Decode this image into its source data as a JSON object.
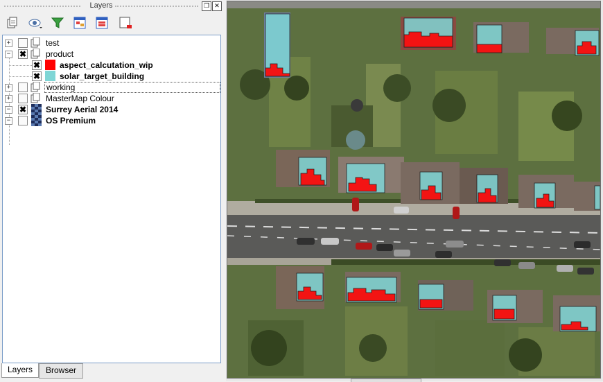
{
  "panel": {
    "title": "Layers",
    "float_glyph": "❐",
    "close_glyph": "✕"
  },
  "toolbar": {
    "buttons": [
      {
        "name": "add-group",
        "icon": "add-group-icon"
      },
      {
        "name": "manage-visibility",
        "icon": "eye-icon"
      },
      {
        "name": "filter-legend",
        "icon": "filter-icon"
      },
      {
        "name": "expand-all",
        "icon": "expand-all-icon"
      },
      {
        "name": "collapse-all",
        "icon": "collapse-all-icon"
      },
      {
        "name": "remove-layer",
        "icon": "remove-layer-icon"
      }
    ]
  },
  "tree": {
    "items": [
      {
        "label": "test",
        "expander": "+",
        "checked": false,
        "bold": false,
        "kind": "group"
      },
      {
        "label": "product",
        "expander": "−",
        "checked": true,
        "bold": false,
        "kind": "group"
      },
      {
        "label": "aspect_calcutation_wip",
        "checked": true,
        "bold": true,
        "kind": "layer",
        "swatch": "#ff0000"
      },
      {
        "label": "solar_target_building",
        "checked": true,
        "bold": true,
        "kind": "layer",
        "swatch": "#7fd6d6"
      },
      {
        "label": "working",
        "expander": "+",
        "checked": false,
        "bold": false,
        "kind": "group",
        "selected": true
      },
      {
        "label": "MasterMap Colour",
        "expander": "+",
        "checked": false,
        "bold": false,
        "kind": "group"
      },
      {
        "label": "Surrey Aerial 2014",
        "expander": "−",
        "checked": true,
        "bold": true,
        "kind": "raster"
      },
      {
        "label": "OS Premium",
        "expander": "−",
        "checked": false,
        "bold": true,
        "kind": "raster"
      }
    ],
    "check_glyph": "✖"
  },
  "tabs": [
    {
      "label": "Layers",
      "active": true
    },
    {
      "label": "Browser",
      "active": false
    }
  ],
  "colors": {
    "aspect_fill": "#ff0000",
    "target_fill": "#7fd6d6",
    "tree_border": "#7a9cc8"
  }
}
